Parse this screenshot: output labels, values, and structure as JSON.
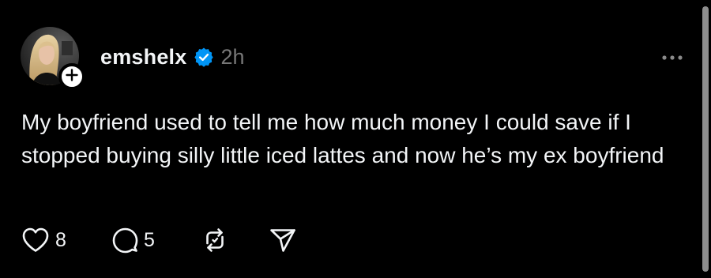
{
  "post": {
    "username": "emshelx",
    "time": "2h",
    "text": "My boyfriend used to tell me how much money I could save if I stopped buying silly little iced lattes and now he’s my ex boyfriend",
    "likes": "8",
    "replies": "5"
  },
  "icons": {
    "verified": "verified-badge-icon",
    "follow": "plus-icon",
    "more": "more-horizontal-icon",
    "like": "heart-icon",
    "reply": "comment-bubble-icon",
    "repost": "repost-icon",
    "share": "send-icon"
  },
  "colors": {
    "background": "#000000",
    "text": "#f3f5f7",
    "muted": "#777777",
    "verified": "#0095f6"
  }
}
